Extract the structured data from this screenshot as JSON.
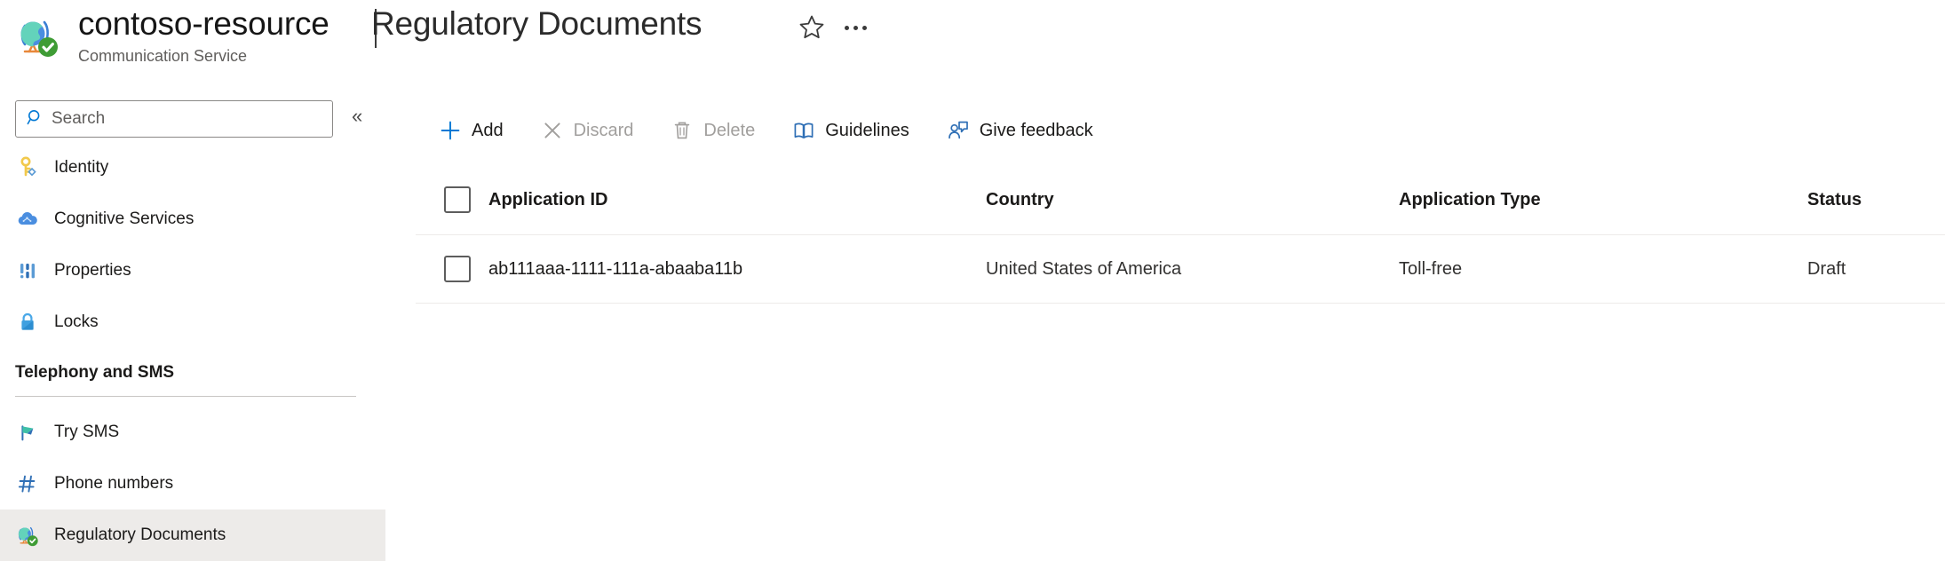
{
  "header": {
    "resource_icon": "globe-check-icon",
    "resource_name": "contoso-resource",
    "resource_subtitle": "Communication Service",
    "separator": "|",
    "page_title": "Regulatory Documents",
    "favorite_icon": "star-icon",
    "more_icon": "ellipsis-icon"
  },
  "sidebar": {
    "search": {
      "placeholder": "Search",
      "value": "",
      "icon": "search-icon"
    },
    "collapse": {
      "icon": "double-chevron-left-icon",
      "glyph": "«"
    },
    "items": [
      {
        "label": "Identity",
        "icon": "key-icon",
        "selected": false
      },
      {
        "label": "Cognitive Services",
        "icon": "cloud-ai-icon",
        "selected": false
      },
      {
        "label": "Properties",
        "icon": "properties-bars-icon",
        "selected": false
      },
      {
        "label": "Locks",
        "icon": "lock-icon",
        "selected": false
      }
    ],
    "group": {
      "title": "Telephony and SMS",
      "items": [
        {
          "label": "Try SMS",
          "icon": "flag-icon",
          "selected": false
        },
        {
          "label": "Phone numbers",
          "icon": "hash-icon",
          "selected": false
        },
        {
          "label": "Regulatory Documents",
          "icon": "globe-check-icon",
          "selected": true
        }
      ]
    }
  },
  "toolbar": {
    "buttons": [
      {
        "label": "Add",
        "icon": "plus-icon",
        "disabled": false
      },
      {
        "label": "Discard",
        "icon": "close-x-icon",
        "disabled": true
      },
      {
        "label": "Delete",
        "icon": "trash-icon",
        "disabled": true
      },
      {
        "label": "Guidelines",
        "icon": "book-icon",
        "disabled": false
      },
      {
        "label": "Give feedback",
        "icon": "feedback-person-icon",
        "disabled": false
      }
    ]
  },
  "table": {
    "select_all": {
      "icon": "checkbox-unchecked-icon",
      "checked": false
    },
    "columns": [
      "Application ID",
      "Country",
      "Application Type",
      "Status"
    ],
    "rows": [
      {
        "checked": false,
        "application_id": "ab111aaa-1111-111a-abaaba11b",
        "country": "United States of America",
        "application_type": "Toll-free",
        "status": "Draft"
      }
    ]
  },
  "colors": {
    "accent": "#0078d4",
    "disabled": "#a19f9d",
    "selected_row_bg": "#edebe9",
    "border": "#edebe9",
    "text": "#1b1a19",
    "subtle_text": "#605e5c"
  }
}
